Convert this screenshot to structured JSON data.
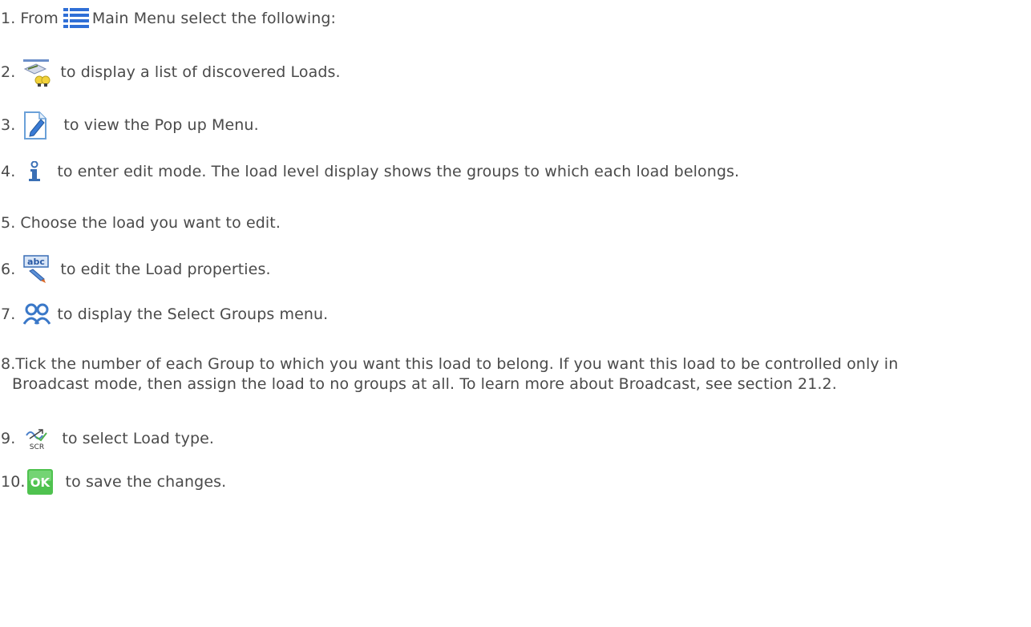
{
  "steps": [
    {
      "num": "1.",
      "pre": "From",
      "text": "Main Menu select the following:",
      "icon": "main-menu-icon"
    },
    {
      "num": "2.",
      "text": "to display a list of discovered Loads.",
      "icon": "loads-icon"
    },
    {
      "num": "3.",
      "text": "to view the Pop up Menu.",
      "icon": "edit-document-icon"
    },
    {
      "num": "4.",
      "text": "to enter edit mode. The load level display shows the groups to which each load belongs.",
      "icon": "info-icon"
    },
    {
      "num": "5.",
      "text": "Choose the load you want to edit."
    },
    {
      "num": "6.",
      "text": "to edit the Load properties.",
      "icon": "abc-properties-icon"
    },
    {
      "num": "7.",
      "text": "to display the Select Groups menu.",
      "icon": "groups-icon"
    },
    {
      "num": "8.",
      "text": "Tick the number of each Group to which you want this load to belong. If you want this load to be controlled only in",
      "text2": "Broadcast mode, then assign the load to no groups at all. To learn more about Broadcast, see section 21.2."
    },
    {
      "num": "9.",
      "text": "to select Load type.",
      "icon": "scr-load-type-icon",
      "icon_label": "SCR"
    },
    {
      "num": "10.",
      "text": "to save the changes.",
      "icon": "ok-icon",
      "icon_label": "OK"
    }
  ],
  "colors": {
    "text": "#4a4a4a",
    "ok_green": "#4fc24f",
    "menu_blue": "#2f6fd6"
  }
}
